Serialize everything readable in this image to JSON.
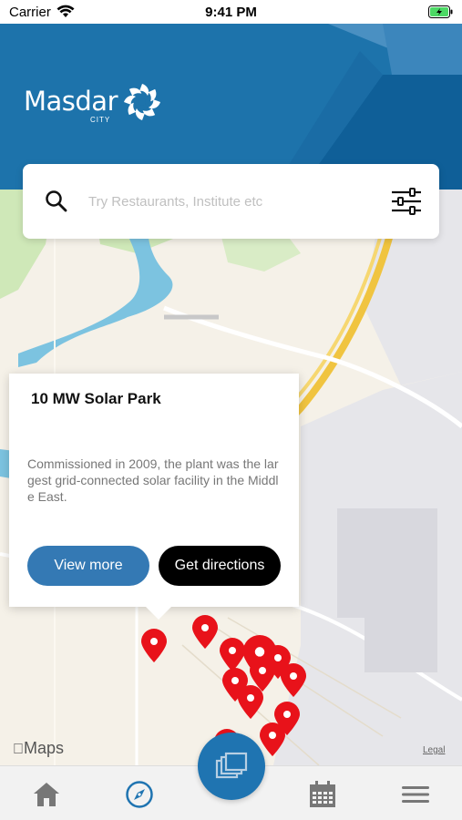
{
  "status_bar": {
    "carrier": "Carrier",
    "time": "9:41 PM",
    "battery": "charging"
  },
  "header": {
    "logo_text": "Masdar",
    "logo_subtext": "CITY",
    "background_color": "#1d73ab"
  },
  "search": {
    "placeholder": "Try Restaurants, Institute etc",
    "value": "",
    "search_icon": "search-icon",
    "filter_icon": "filter-sliders-icon"
  },
  "map": {
    "provider": "Maps",
    "legal": "Legal",
    "pin_color": "#e8121a"
  },
  "popup": {
    "title": "10 MW Solar Park",
    "description": "Commissioned in 2009, the plant was the largest grid-connected solar facility in the Middle East.",
    "view_more_label": "View more",
    "directions_label": "Get directions",
    "view_more_color": "#3479b4",
    "directions_color": "#000000"
  },
  "tab_bar": {
    "items": [
      {
        "icon": "home-icon",
        "active": false
      },
      {
        "icon": "compass-icon",
        "active": true
      },
      {
        "icon": "gallery-icon",
        "active": false,
        "center": true
      },
      {
        "icon": "calendar-icon",
        "active": false
      },
      {
        "icon": "menu-icon",
        "active": false
      }
    ],
    "active_color": "#1f74b1",
    "inactive_color": "#777777"
  }
}
